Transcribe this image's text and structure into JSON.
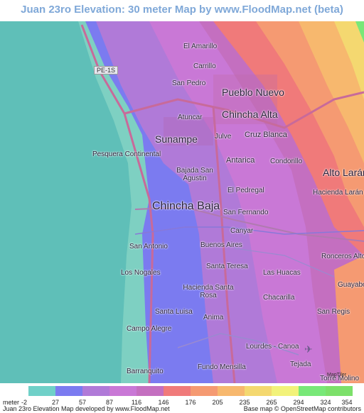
{
  "title": "Juan 23ro Elevation: 30 meter Map by www.FloodMap.net (beta)",
  "road_label": "PE-1S",
  "places": [
    {
      "name": "El Amarillo",
      "cls": "small"
    },
    {
      "name": "Carrillo",
      "cls": "small"
    },
    {
      "name": "San Pedro",
      "cls": "small"
    },
    {
      "name": "Pueblo Nuevo",
      "cls": "big"
    },
    {
      "name": "Chincha Alta",
      "cls": "big"
    },
    {
      "name": "Atuncar",
      "cls": "small"
    },
    {
      "name": "Sunampe",
      "cls": "big"
    },
    {
      "name": "Julve",
      "cls": "small"
    },
    {
      "name": "Cruz Blanca",
      "cls": "med"
    },
    {
      "name": "Pesquera Continental",
      "cls": "small"
    },
    {
      "name": "Antarica",
      "cls": "med"
    },
    {
      "name": "Condorillo",
      "cls": "small"
    },
    {
      "name": "Alto Larán",
      "cls": "big"
    },
    {
      "name": "Bajada San Agustin",
      "cls": "small"
    },
    {
      "name": "El Pedregal",
      "cls": "small"
    },
    {
      "name": "Hacienda Larán",
      "cls": "small"
    },
    {
      "name": "Chincha Baja",
      "cls": "xbig"
    },
    {
      "name": "San Fernando",
      "cls": "small"
    },
    {
      "name": "Canyar",
      "cls": "small"
    },
    {
      "name": "San Antonio",
      "cls": "small"
    },
    {
      "name": "Buenos Aires",
      "cls": "small"
    },
    {
      "name": "Ronceros Alto",
      "cls": "small"
    },
    {
      "name": "Los Nogales",
      "cls": "small"
    },
    {
      "name": "Santa Teresa",
      "cls": "small"
    },
    {
      "name": "Las Huacas",
      "cls": "small"
    },
    {
      "name": "Guayabo",
      "cls": "small"
    },
    {
      "name": "Hacienda Santa Rosa",
      "cls": "small"
    },
    {
      "name": "Chacarilla",
      "cls": "small"
    },
    {
      "name": "Santa Luisa",
      "cls": "small"
    },
    {
      "name": "San Regis",
      "cls": "small"
    },
    {
      "name": "Anima",
      "cls": "small"
    },
    {
      "name": "Campo Alegre",
      "cls": "small"
    },
    {
      "name": "Lourdes - Canoa",
      "cls": "small"
    },
    {
      "name": "Fundo Mensilla",
      "cls": "small"
    },
    {
      "name": "Tejada",
      "cls": "small"
    },
    {
      "name": "Barranquito",
      "cls": "small"
    },
    {
      "name": "Torre Molino",
      "cls": "small"
    }
  ],
  "legend": {
    "unit_label": "meter",
    "ticks": [
      "-2",
      "27",
      "57",
      "87",
      "116",
      "146",
      "176",
      "205",
      "235",
      "265",
      "294",
      "324",
      "354"
    ],
    "colors": [
      "#6fd0c8",
      "#7b7bf0",
      "#b07ad8",
      "#c978d6",
      "#c46fc0",
      "#f07a7a",
      "#f59a72",
      "#f7b86e",
      "#f4d870",
      "#f2f27a",
      "#78e878",
      "#7ce06a"
    ]
  },
  "footer": {
    "left": "Juan 23ro Elevation Map developed by www.FloodMap.net",
    "right": "Base map © OpenStreetMap contributors"
  },
  "logo_text": "MapTiler"
}
